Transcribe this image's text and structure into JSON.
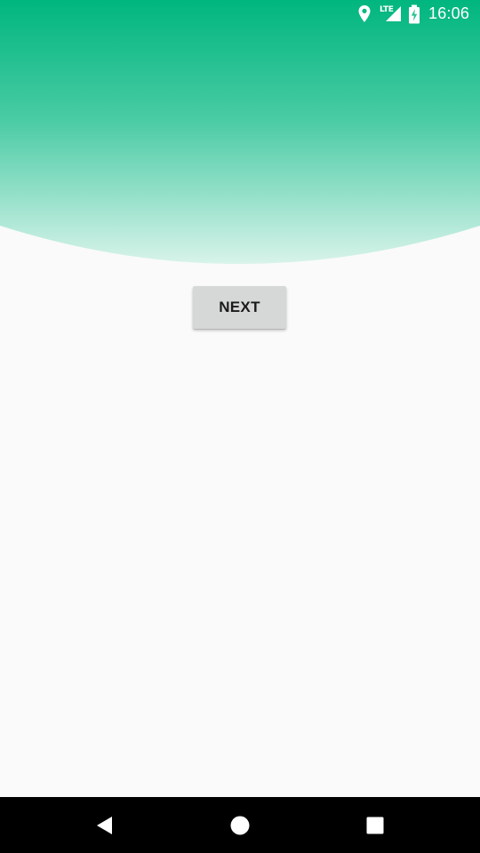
{
  "status_bar": {
    "time": "16:06",
    "network_label": "LTE",
    "icons": [
      "location-icon",
      "signal-icon",
      "battery-charging-icon"
    ]
  },
  "header": {
    "gradient_top_color": "#00b67f",
    "gradient_bottom_color": "#d8f3ea"
  },
  "main": {
    "next_button_label": "NEXT"
  },
  "nav_bar": {
    "icons": [
      "back-icon",
      "home-icon",
      "recents-icon"
    ]
  },
  "colors": {
    "background": "#fafafa",
    "button_bg": "#d6d7d7",
    "nav_bar_bg": "#000000"
  }
}
